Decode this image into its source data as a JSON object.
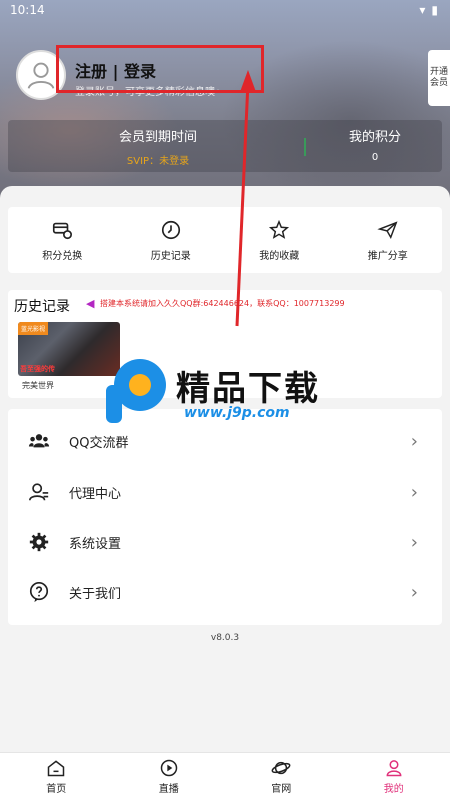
{
  "status_bar": {
    "time": "10:14",
    "wifi_icon": "wifi-icon",
    "battery_icon": "battery-icon"
  },
  "header": {
    "title": "注册 | 登录",
    "subtitle": "登录账号，可享更多精彩信息噢～",
    "vip_tab": "开通会员",
    "member": {
      "expiry_label": "会员到期时间",
      "expiry_value": "SVIP：未登录",
      "points_label": "我的积分",
      "points_value": "0"
    }
  },
  "shortcuts": [
    {
      "label": "积分兑换",
      "icon": "points-exchange-icon"
    },
    {
      "label": "历史记录",
      "icon": "history-icon"
    },
    {
      "label": "我的收藏",
      "icon": "favorites-icon"
    },
    {
      "label": "推广分享",
      "icon": "share-icon"
    }
  ],
  "history": {
    "title": "历史记录",
    "announcement": "搭建本系统请加入久久QQ群:642446624，联系QQ：1007713299",
    "items": [
      {
        "title": "完美世界",
        "tag": "蓝光影视",
        "caption": "吾至强的传"
      }
    ]
  },
  "menu": [
    {
      "label": "QQ交流群",
      "icon": "group-icon"
    },
    {
      "label": "代理中心",
      "icon": "agent-icon"
    },
    {
      "label": "系统设置",
      "icon": "settings-icon"
    },
    {
      "label": "关于我们",
      "icon": "about-icon"
    }
  ],
  "version": "v8.0.3",
  "tabs": [
    {
      "label": "首页",
      "icon": "home-icon"
    },
    {
      "label": "直播",
      "icon": "live-icon"
    },
    {
      "label": "官网",
      "icon": "planet-icon"
    },
    {
      "label": "我的",
      "icon": "profile-icon",
      "active": true
    }
  ],
  "watermark": {
    "text": "精品下载",
    "url": "www.j9p.com"
  },
  "colors": {
    "accent": "#e0307a",
    "highlight": "#e0262a",
    "gold": "#e7a51a"
  }
}
